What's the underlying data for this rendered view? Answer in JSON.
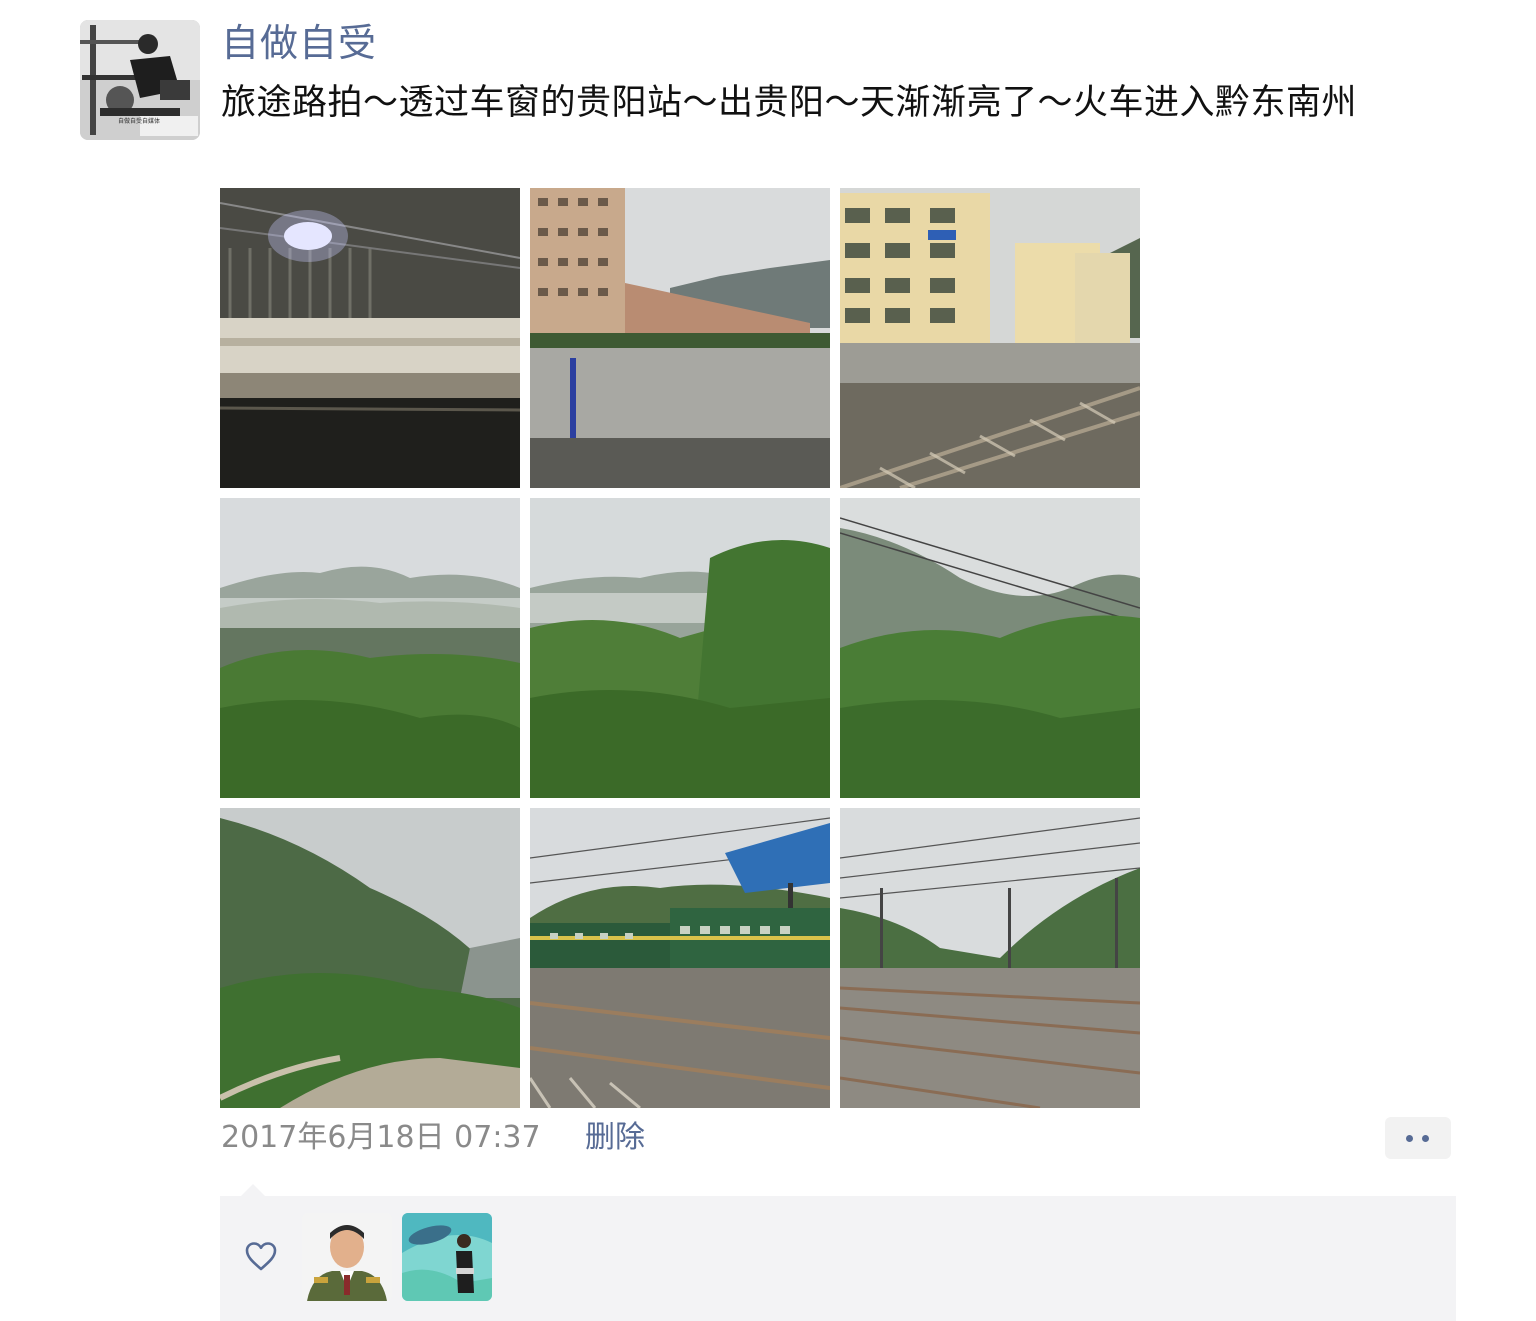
{
  "post": {
    "author": "自做自受",
    "avatar_caption": "自做自受自媒体",
    "avatar_caption_2": "www.easybright.com",
    "text": "旅途路拍～透过车窗的贵阳站～出贵阳～天渐渐亮了～火车进入黔东南州",
    "timestamp": "2017年6月18日 07:37",
    "delete_label": "删除"
  },
  "photos": [
    {
      "scene": "train-station-platform-night"
    },
    {
      "scene": "apartment-buildings-wall"
    },
    {
      "scene": "apartment-buildings-tracks"
    },
    {
      "scene": "misty-hills-forest"
    },
    {
      "scene": "misty-hills-trees-blur"
    },
    {
      "scene": "hills-power-lines"
    },
    {
      "scene": "green-mountain-slope"
    },
    {
      "scene": "green-train-station"
    },
    {
      "scene": "railway-yard-tracks"
    }
  ],
  "likes": {
    "icon": "heart-icon",
    "users": [
      {
        "avatar": "uniform-portrait"
      },
      {
        "avatar": "aquarium-portrait"
      }
    ]
  },
  "colors": {
    "link": "#576b95",
    "text": "#111111",
    "muted": "#8a8a8a",
    "panel": "#f3f3f5"
  }
}
